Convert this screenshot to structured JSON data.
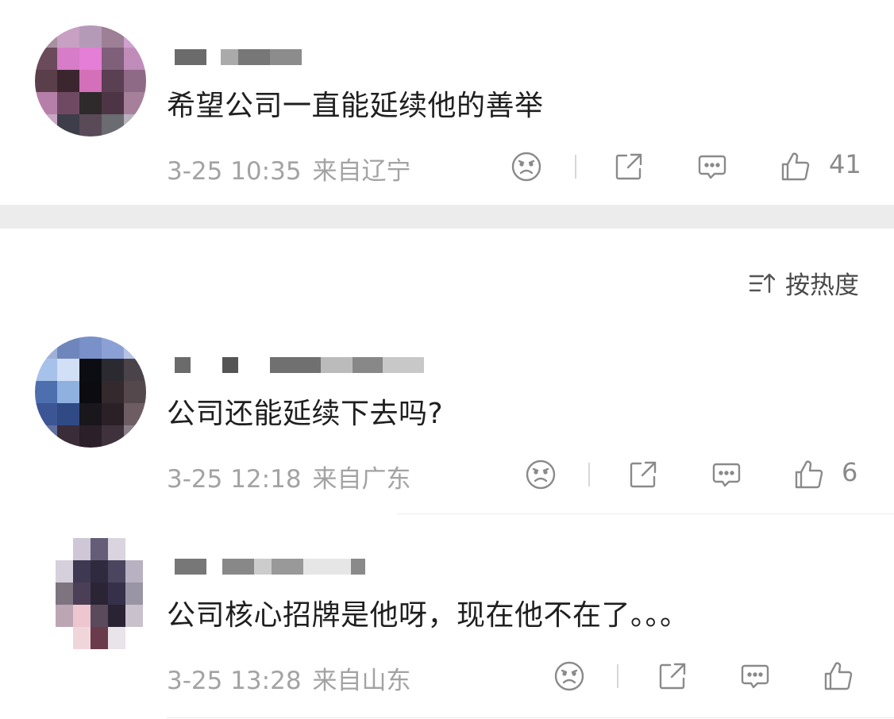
{
  "comments": [
    {
      "text": "希望公司一直能延续他的善举",
      "time": "3-25 10:35",
      "location": "来自辽宁",
      "likes": "41",
      "avatar_colors": [
        [
          "#a98fa0",
          "#c8a0c4",
          "#b59ab8",
          "#9d7f96",
          "#cfa0d0"
        ],
        [
          "#6b4a5c",
          "#d67cc8",
          "#e47ed6",
          "#7f5f79",
          "#c08cb9"
        ],
        [
          "#5a3f4b",
          "#3b2630",
          "#d46fb9",
          "#5b3f52",
          "#8e6a86"
        ],
        [
          "#b67fa9",
          "#6f4962",
          "#2e2a2c",
          "#4e3546",
          "#a6809a"
        ],
        [
          "#c7a6c1",
          "#3e3d4a",
          "#5a4a58",
          "#6b6b72",
          "#b8b2bd"
        ]
      ]
    },
    {
      "text": "公司还能延续下去吗?",
      "time": "3-25 12:18",
      "location": "来自广东",
      "likes": "6",
      "avatar_colors": [
        [
          "#9fb0d8",
          "#6f86bd",
          "#7990c9",
          "#8ba1d6",
          "#b6c3e4"
        ],
        [
          "#a7c2ea",
          "#d1e0f6",
          "#0c0d12",
          "#2b2a30",
          "#4a4349"
        ],
        [
          "#4e6fae",
          "#8fb1e0",
          "#0b0b10",
          "#34292d",
          "#54484d"
        ],
        [
          "#3c5595",
          "#304a86",
          "#19161c",
          "#2a2026",
          "#6d5d63"
        ],
        [
          "#5f6f9e",
          "#3b2c3a",
          "#2b1f2a",
          "#40323d",
          "#8c8088"
        ]
      ]
    },
    {
      "text": "公司核心招牌是他呀，现在他不在了。。。",
      "time": "3-25 13:28",
      "location": "来自山东",
      "likes": "",
      "avatar_colors": [
        [
          "#ffffff",
          "#cfc7d6",
          "#655d77",
          "#d9d4de",
          "#ffffff"
        ],
        [
          "#d6d0dc",
          "#3f3852",
          "#2f2a3d",
          "#4b4560",
          "#b7b1c2"
        ],
        [
          "#7d7480",
          "#4b3f57",
          "#2a2434",
          "#37304a",
          "#9a95a4"
        ],
        [
          "#bda6b4",
          "#edc6cf",
          "#5b4a5c",
          "#2a2333",
          "#c9c1cc"
        ],
        [
          "#ffffff",
          "#f0d6db",
          "#6a3b4a",
          "#e9e3ea",
          "#ffffff"
        ]
      ]
    }
  ],
  "sort": {
    "label": "按热度"
  },
  "icons": {
    "dislike": "frown-face-icon",
    "share": "share-icon",
    "comment": "chat-bubble-icon",
    "like": "thumbs-up-icon",
    "sort": "sort-icon"
  },
  "colors": {
    "meta_text": "#a3a3a3",
    "icon_stroke": "#8a8a8a",
    "separator_band": "#ececec"
  }
}
